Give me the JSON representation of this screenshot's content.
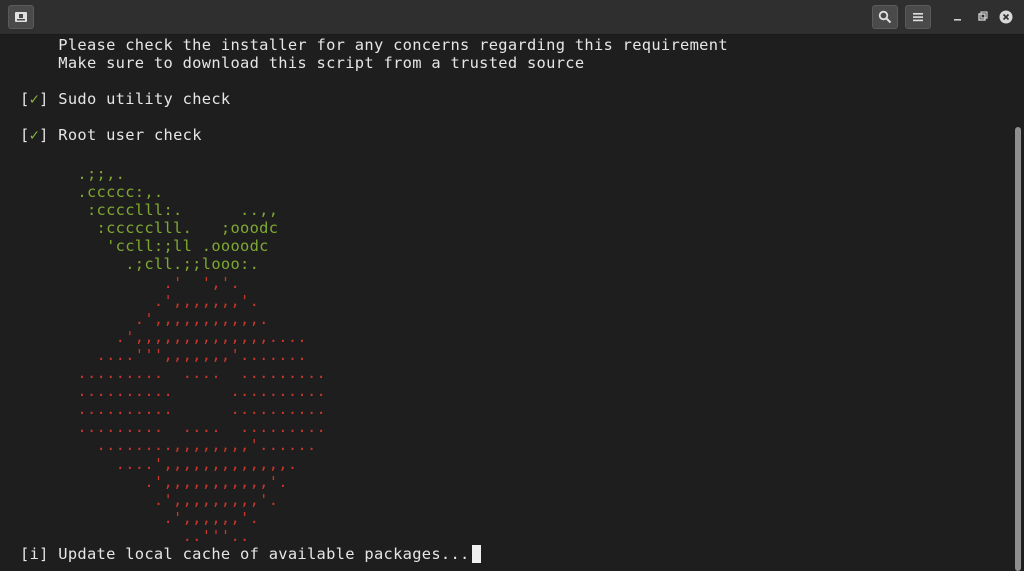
{
  "titlebar": {
    "new_tab_icon": "new-tab-icon",
    "search_icon": "search-icon",
    "menu_icon": "hamburger-menu-icon",
    "minimize_icon": "minimize-icon",
    "restore_icon": "restore-icon",
    "close_icon": "close-icon"
  },
  "terminal": {
    "line1": "    Please check the installer for any concerns regarding this requirement",
    "line2": "    Make sure to download this script from a trusted source",
    "check1_open": "[",
    "check1_mark": "✓",
    "check1_close": "] Sudo utility check",
    "check2_open": "[",
    "check2_mark": "✓",
    "check2_close": "] Root user check",
    "prompt_line": "[i] Update local cache of available packages...",
    "colors": {
      "text": "#e6e6e6",
      "check": "#8ab33f",
      "logo_green": "#7fa832",
      "logo_red": "#c9362a"
    }
  },
  "logo": {
    "green": [
      "      .;;,.",
      "      .ccccc:,.",
      "       :cccclll:.      ..,,",
      "        :ccccclll.   ;ooodc",
      "         'ccll:;ll .oooodc",
      "           .;cll.;;looo:."
    ],
    "red": [
      "               .'  ','.",
      "              .',,,,,,,'.",
      "            .',,,,,,,,,,,.",
      "          .',,,,,,,,,,,,,,....",
      "        ....''',,,,,,,'.......",
      "      .........  ....  .........",
      "      ..........      ..........",
      "      ..........      ..........",
      "      .........  ....  .........",
      "        ........,,,,,,,,'......",
      "          ....',,,,,,,,,,,,,.",
      "             .',,,,,,,,,,,'.",
      "              .',,,,,,,,,'.",
      "               .',,,,,,'.",
      "                 ..'''.."
    ]
  }
}
